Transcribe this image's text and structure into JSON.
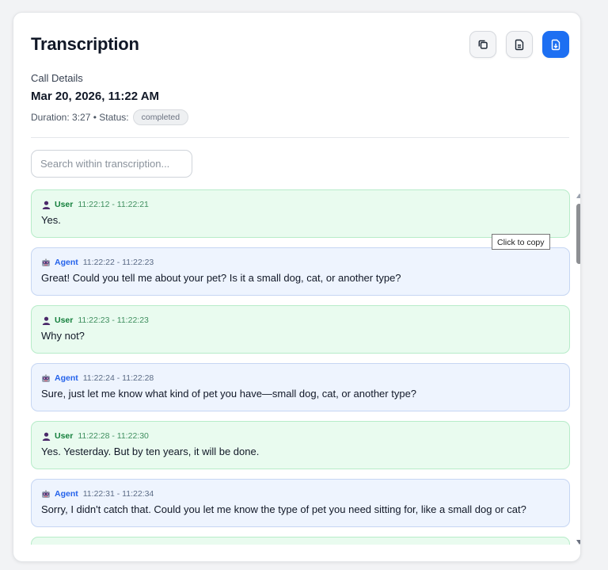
{
  "header": {
    "title": "Transcription",
    "actions": [
      {
        "name": "copy",
        "icon": "copy-icon"
      },
      {
        "name": "text-file",
        "icon": "file-text-icon"
      },
      {
        "name": "download",
        "icon": "file-download-icon"
      }
    ]
  },
  "details": {
    "label": "Call Details",
    "date": "Mar 20, 2026, 11:22 AM",
    "duration_prefix": "Duration: 3:27 • Status:",
    "status": "completed"
  },
  "search": {
    "placeholder": "Search within transcription...",
    "value": ""
  },
  "messages": [
    {
      "speaker": "User",
      "icon": "user-icon",
      "time": "11:22:12 - 11:22:21",
      "text": "Yes."
    },
    {
      "speaker": "Agent",
      "icon": "robot-icon",
      "time": "11:22:22 - 11:22:23",
      "text": "Great! Could you tell me about your pet? Is it a small dog, cat, or another type?"
    },
    {
      "speaker": "User",
      "icon": "user-icon",
      "time": "11:22:23 - 11:22:23",
      "text": "Why not?"
    },
    {
      "speaker": "Agent",
      "icon": "robot-icon",
      "time": "11:22:24 - 11:22:28",
      "text": "Sure, just let me know what kind of pet you have—small dog, cat, or another type?"
    },
    {
      "speaker": "User",
      "icon": "user-icon",
      "time": "11:22:28 - 11:22:30",
      "text": "Yes. Yesterday. But by ten years, it will be done."
    },
    {
      "speaker": "Agent",
      "icon": "robot-icon",
      "time": "11:22:31 - 11:22:34",
      "text": "Sorry, I didn't catch that. Could you let me know the type of pet you need sitting for, like a small dog or cat?"
    }
  ],
  "tooltip": "Click to copy",
  "colors": {
    "accent": "#1d6ff2",
    "user_bg": "#e9fbef",
    "agent_bg": "#eef4fe",
    "user_label": "#15803d",
    "agent_label": "#2563eb"
  }
}
